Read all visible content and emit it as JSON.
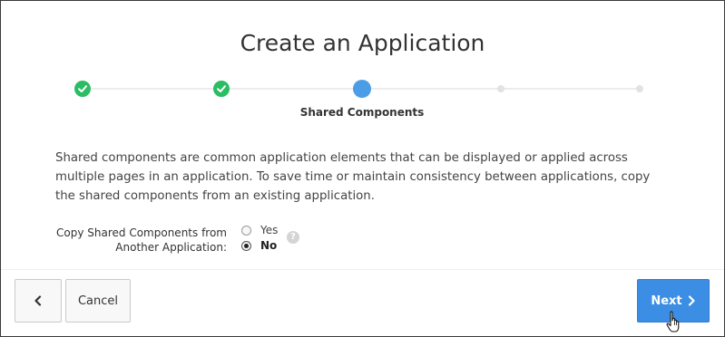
{
  "page": {
    "title": "Create an Application"
  },
  "wizard": {
    "current_step_label": "Shared Components",
    "steps": [
      {
        "status": "complete"
      },
      {
        "status": "complete"
      },
      {
        "status": "current"
      },
      {
        "status": "upcoming"
      },
      {
        "status": "upcoming"
      }
    ],
    "colors": {
      "complete": "#2bbd64",
      "current": "#4b9ee6",
      "upcoming": "#e2e2e2"
    }
  },
  "description": "Shared components are common application elements that can be displayed or applied across multiple pages in an application. To save time or maintain consistency between applications, copy the shared components from an existing application.",
  "copy_field": {
    "label_line1": "Copy Shared Components from",
    "label_line2": "Another Application:",
    "options": [
      {
        "label": "Yes",
        "selected": false
      },
      {
        "label": "No",
        "selected": true
      }
    ],
    "help_icon": "?"
  },
  "footer": {
    "back_icon": "chevron-left-icon",
    "cancel_label": "Cancel",
    "next_label": "Next",
    "next_icon": "chevron-right-icon",
    "accent_color": "#3b8ee3"
  }
}
